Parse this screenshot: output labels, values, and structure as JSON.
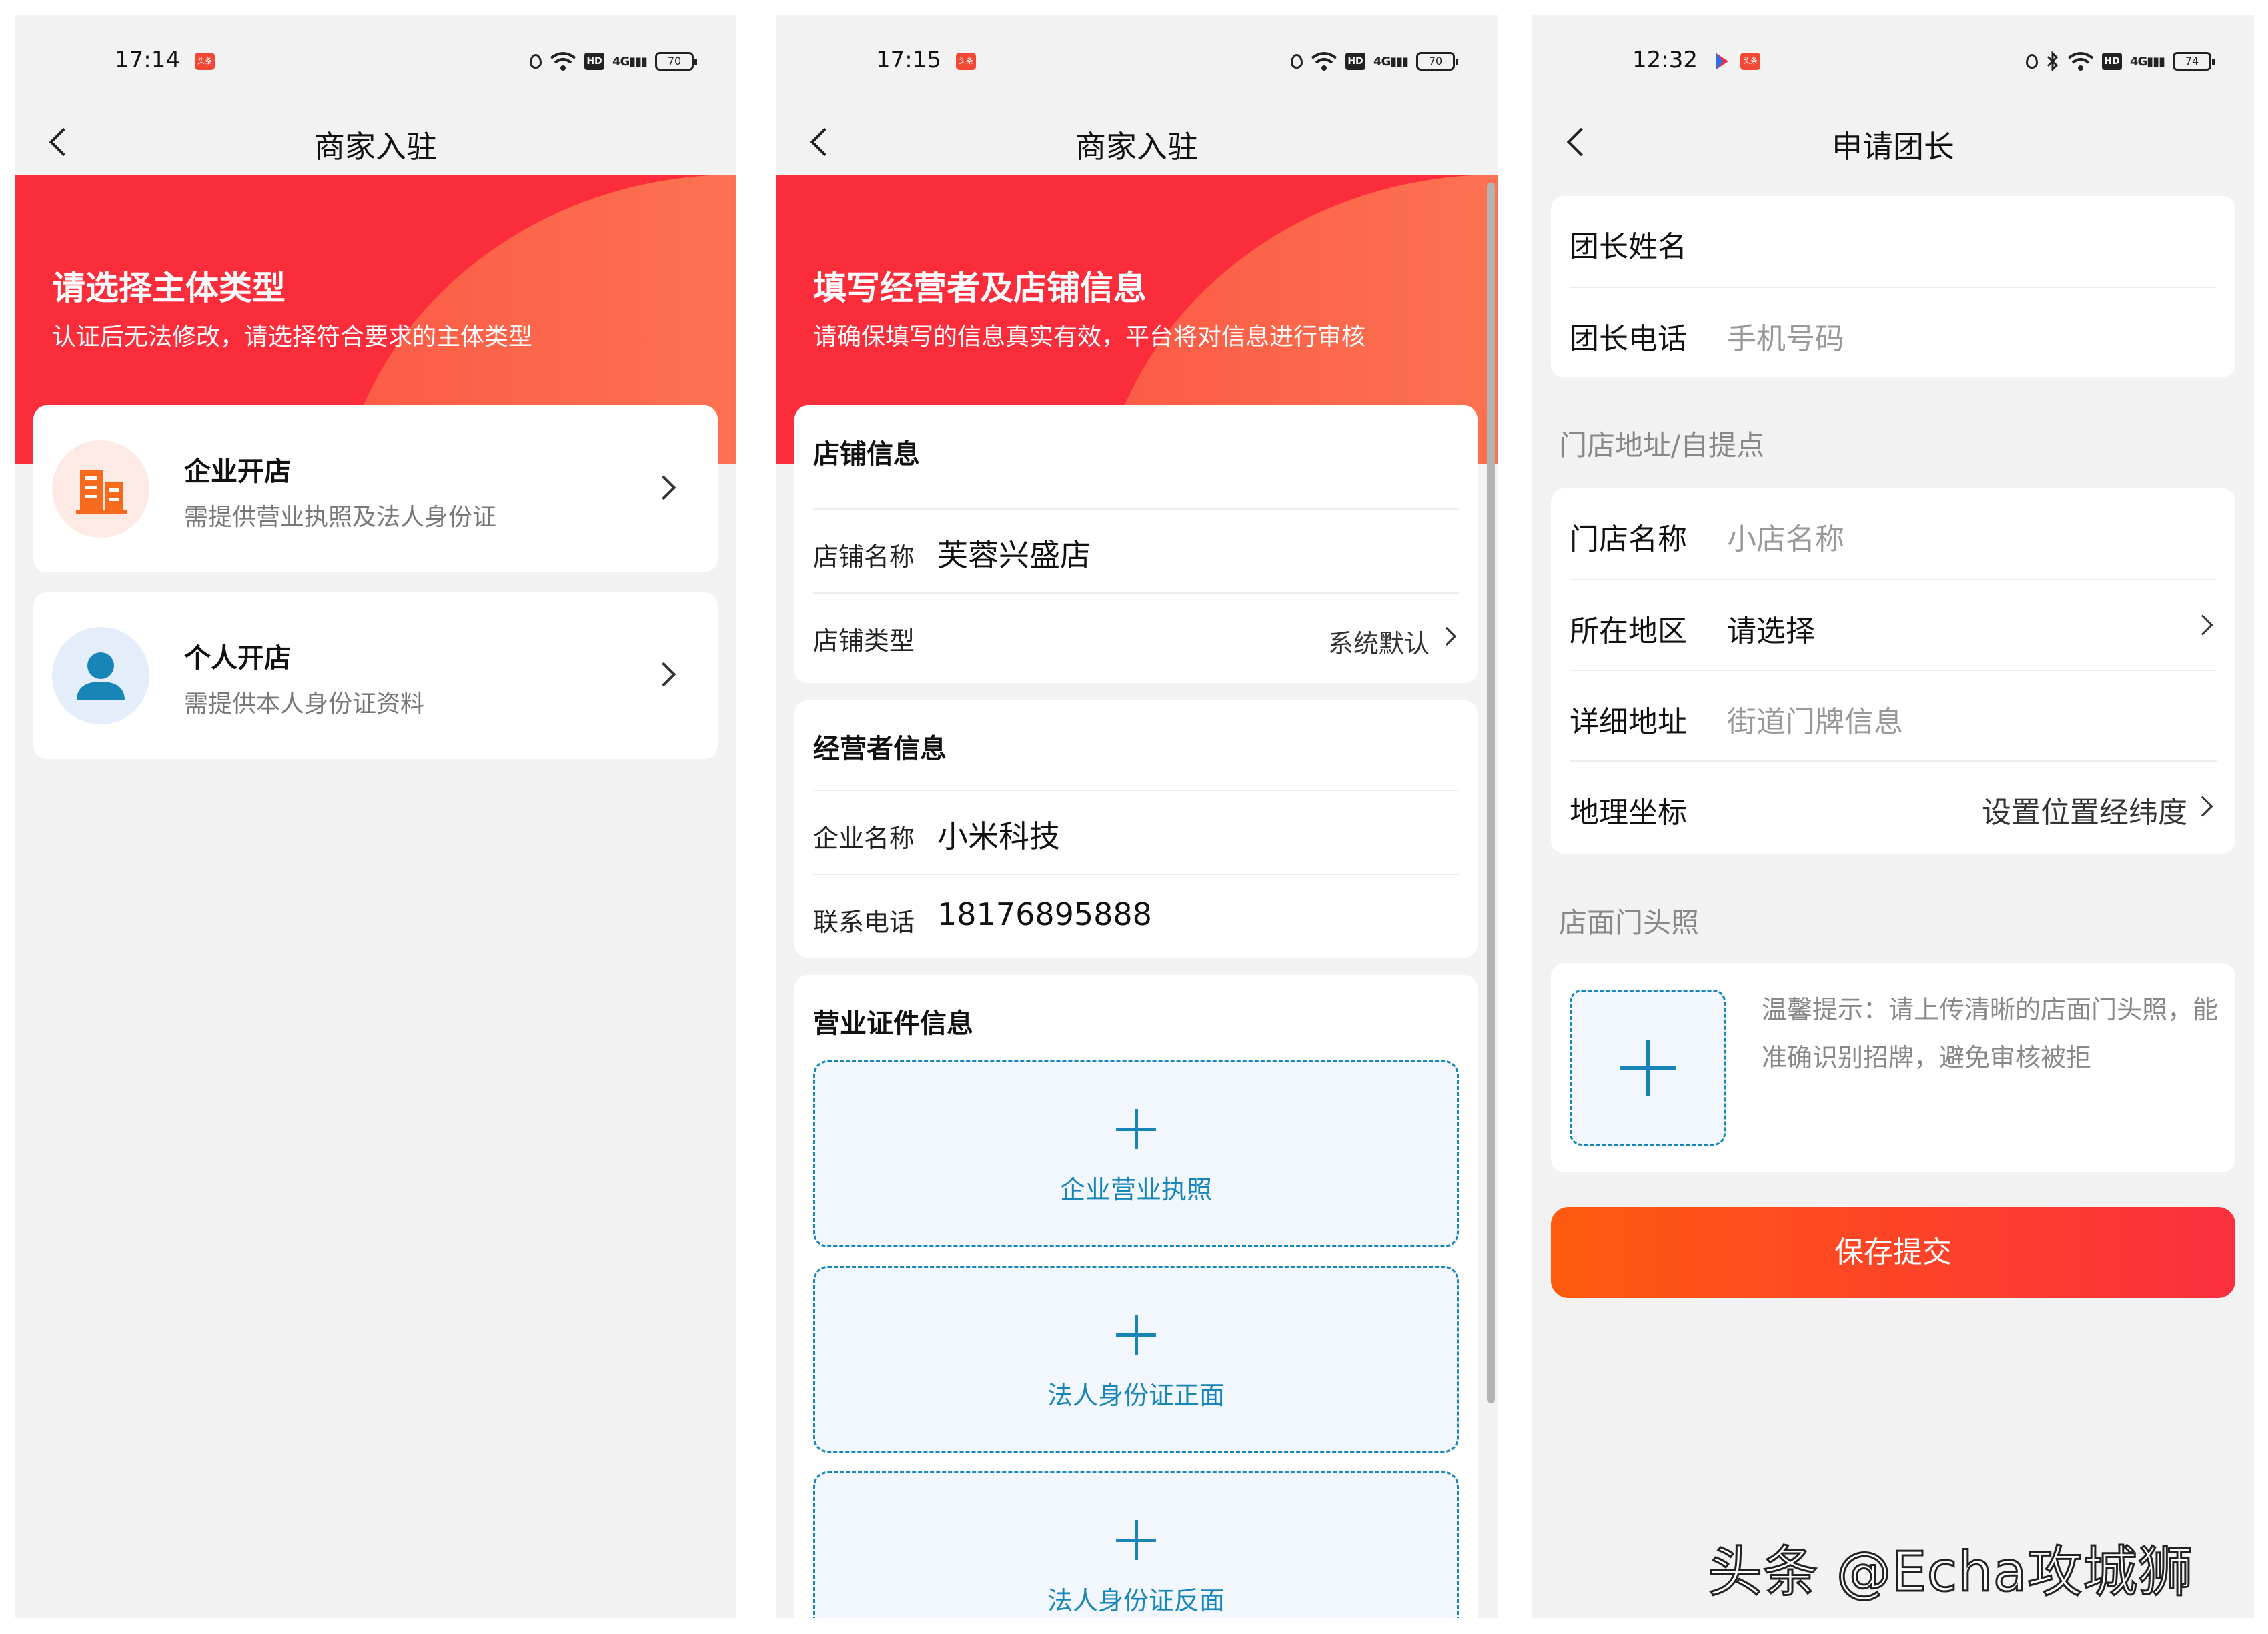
{
  "screens": [
    {
      "status": {
        "time": "17:14",
        "badge": "头条",
        "battery": "70"
      },
      "nav_title": "商家入驻",
      "header": {
        "title": "请选择主体类型",
        "subtitle": "认证后无法修改，请选择符合要求的主体类型"
      },
      "options": [
        {
          "title": "企业开店",
          "subtitle": "需提供营业执照及法人身份证",
          "icon": "building-icon",
          "color": "#f56a1d"
        },
        {
          "title": "个人开店",
          "subtitle": "需提供本人身份证资料",
          "icon": "person-icon",
          "color": "#1785b8"
        }
      ]
    },
    {
      "status": {
        "time": "17:15",
        "badge": "头条",
        "battery": "70"
      },
      "nav_title": "商家入驻",
      "header": {
        "title": "填写经营者及店铺信息",
        "subtitle": "请确保填写的信息真实有效，平台将对信息进行审核"
      },
      "store": {
        "section_title": "店铺信息",
        "name_label": "店铺名称",
        "name_value": "芙蓉兴盛店",
        "type_label": "店铺类型",
        "type_value": "系统默认"
      },
      "operator": {
        "section_title": "经营者信息",
        "company_label": "企业名称",
        "company_value": "小米科技",
        "phone_label": "联系电话",
        "phone_value": "18176895888"
      },
      "license": {
        "section_title": "营业证件信息",
        "uploads": [
          "企业营业执照",
          "法人身份证正面",
          "法人身份证反面"
        ]
      }
    },
    {
      "status": {
        "time": "12:32",
        "badge": "头条",
        "battery": "74"
      },
      "nav_title": "申请团长",
      "leader": {
        "name_label": "团长姓名",
        "phone_label": "团长电话",
        "phone_placeholder": "手机号码"
      },
      "address_group_label": "门店地址/自提点",
      "address": {
        "store_label": "门店名称",
        "store_placeholder": "小店名称",
        "region_label": "所在地区",
        "region_value": "请选择",
        "detail_label": "详细地址",
        "detail_placeholder": "街道门牌信息",
        "coord_label": "地理坐标",
        "coord_value": "设置位置经纬度"
      },
      "photo_group_label": "店面门头照",
      "photo_tip": "温馨提示：请上传清晰的店面门头照，能准确识别招牌，避免审核被拒",
      "submit_label": "保存提交"
    }
  ],
  "watermark": "头条 @Echa攻城狮",
  "colors": {
    "red": "#fb2d3b",
    "orange": "#ff8a5c",
    "blue": "#1785b8",
    "bg": "#f2f2f2"
  }
}
